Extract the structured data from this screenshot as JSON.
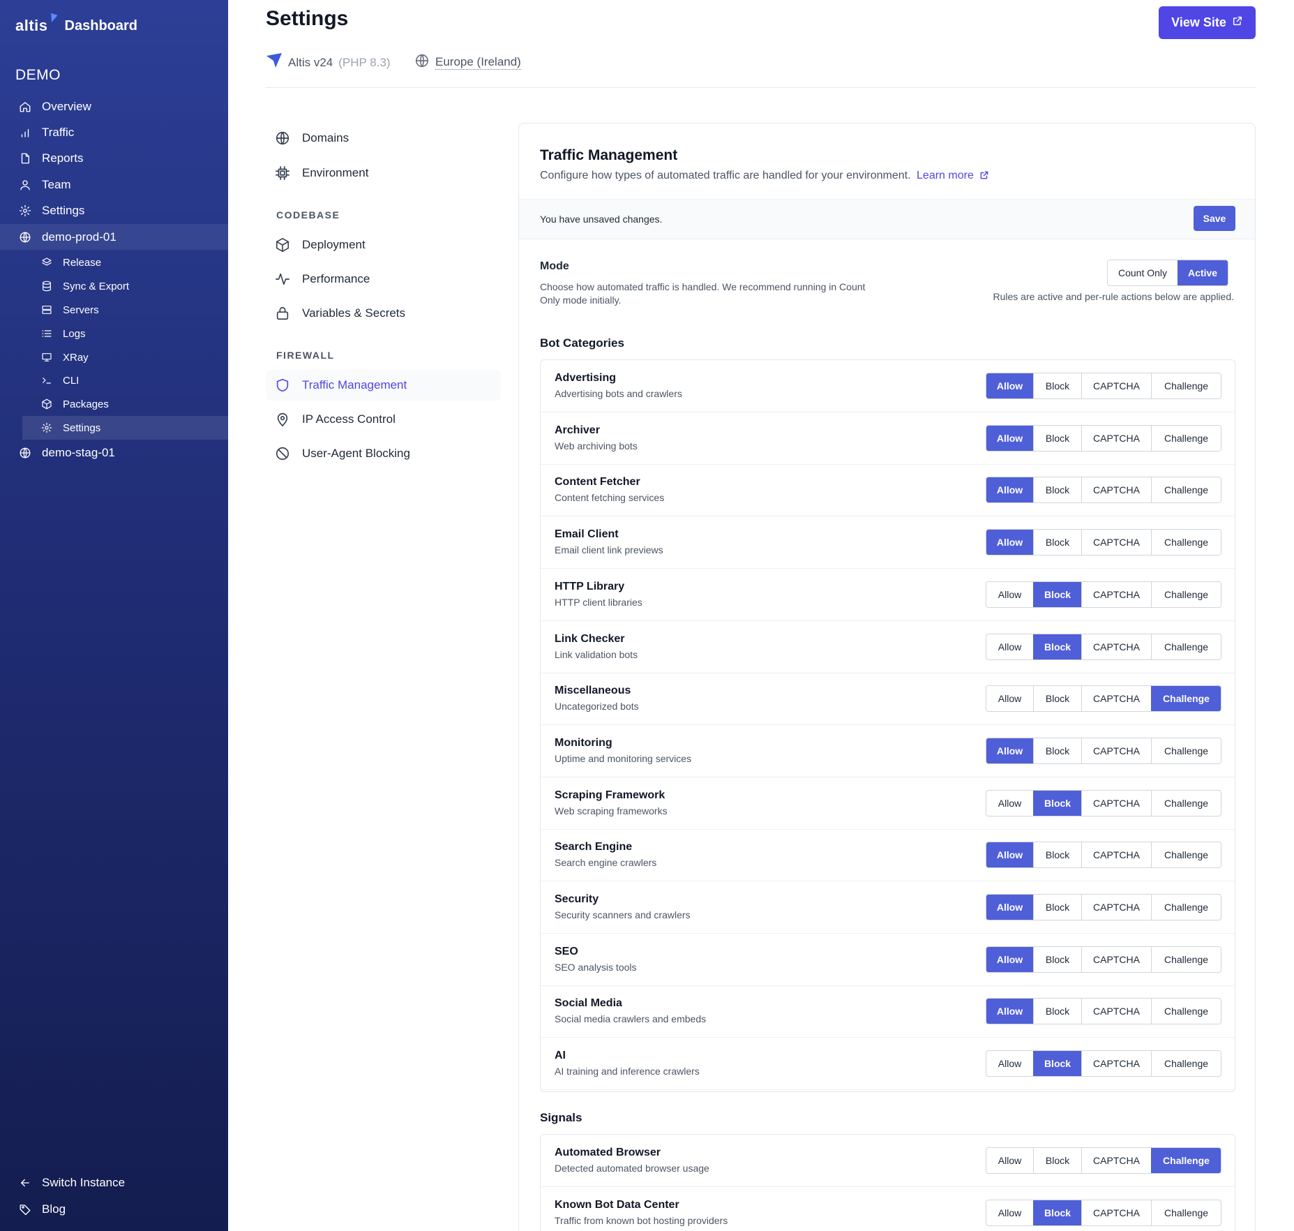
{
  "sidebar": {
    "logo": "altis",
    "title": "Dashboard",
    "org": "DEMO",
    "items": [
      {
        "label": "Overview",
        "icon": "home-icon"
      },
      {
        "label": "Traffic",
        "icon": "bar-chart-icon"
      },
      {
        "label": "Reports",
        "icon": "document-icon"
      },
      {
        "label": "Team",
        "icon": "user-icon"
      },
      {
        "label": "Settings",
        "icon": "gear-icon"
      }
    ],
    "env_prod": "demo-prod-01",
    "env_items": [
      {
        "label": "Release",
        "icon": "layers-icon"
      },
      {
        "label": "Sync & Export",
        "icon": "database-icon"
      },
      {
        "label": "Servers",
        "icon": "server-icon"
      },
      {
        "label": "Logs",
        "icon": "list-icon"
      },
      {
        "label": "XRay",
        "icon": "monitor-icon"
      },
      {
        "label": "CLI",
        "icon": "terminal-icon"
      },
      {
        "label": "Packages",
        "icon": "package-icon"
      },
      {
        "label": "Settings",
        "icon": "gear-icon"
      }
    ],
    "env_stag": "demo-stag-01",
    "footer": [
      {
        "label": "Switch Instance",
        "icon": "arrow-left-icon"
      },
      {
        "label": "Blog",
        "icon": "tag-icon"
      }
    ]
  },
  "header": {
    "title": "Settings",
    "view_site": "View Site",
    "version": "Altis v24",
    "php": "(PHP 8.3)",
    "region": "Europe (Ireland)"
  },
  "subnav": {
    "domains": "Domains",
    "environment": "Environment",
    "codebase_heading": "CODEBASE",
    "deployment": "Deployment",
    "performance": "Performance",
    "variables": "Variables & Secrets",
    "firewall_heading": "FIREWALL",
    "traffic": "Traffic Management",
    "ip_access": "IP Access Control",
    "ua_blocking": "User-Agent Blocking"
  },
  "panel": {
    "title": "Traffic Management",
    "description": "Configure how types of automated traffic are handled for your environment.",
    "learn_more": "Learn more",
    "unsaved": "You have unsaved changes.",
    "save": "Save",
    "mode_label": "Mode",
    "mode_help": "Choose how automated traffic is handled. We recommend running in Count Only mode initially.",
    "mode_options": [
      "Count Only",
      "Active"
    ],
    "mode_selected": "Active",
    "mode_note": "Rules are active and per-rule actions below are applied.",
    "bot_categories_title": "Bot Categories",
    "signals_title": "Signals",
    "actions": [
      "Allow",
      "Block",
      "CAPTCHA",
      "Challenge"
    ],
    "bot_categories": [
      {
        "name": "Advertising",
        "desc": "Advertising bots and crawlers",
        "selected": "Allow"
      },
      {
        "name": "Archiver",
        "desc": "Web archiving bots",
        "selected": "Allow"
      },
      {
        "name": "Content Fetcher",
        "desc": "Content fetching services",
        "selected": "Allow"
      },
      {
        "name": "Email Client",
        "desc": "Email client link previews",
        "selected": "Allow"
      },
      {
        "name": "HTTP Library",
        "desc": "HTTP client libraries",
        "selected": "Block"
      },
      {
        "name": "Link Checker",
        "desc": "Link validation bots",
        "selected": "Block"
      },
      {
        "name": "Miscellaneous",
        "desc": "Uncategorized bots",
        "selected": "Challenge"
      },
      {
        "name": "Monitoring",
        "desc": "Uptime and monitoring services",
        "selected": "Allow"
      },
      {
        "name": "Scraping Framework",
        "desc": "Web scraping frameworks",
        "selected": "Block"
      },
      {
        "name": "Search Engine",
        "desc": "Search engine crawlers",
        "selected": "Allow"
      },
      {
        "name": "Security",
        "desc": "Security scanners and crawlers",
        "selected": "Allow"
      },
      {
        "name": "SEO",
        "desc": "SEO analysis tools",
        "selected": "Allow"
      },
      {
        "name": "Social Media",
        "desc": "Social media crawlers and embeds",
        "selected": "Allow"
      },
      {
        "name": "AI",
        "desc": "AI training and inference crawlers",
        "selected": "Block"
      }
    ],
    "signals": [
      {
        "name": "Automated Browser",
        "desc": "Detected automated browser usage",
        "selected": "Challenge"
      },
      {
        "name": "Known Bot Data Center",
        "desc": "Traffic from known bot hosting providers",
        "selected": "Block"
      }
    ]
  },
  "colors": {
    "accent": "#4f46e5",
    "selected": "#4f5fd8",
    "sidebar_top": "#2c3e96",
    "sidebar_bottom": "#141d4f"
  }
}
